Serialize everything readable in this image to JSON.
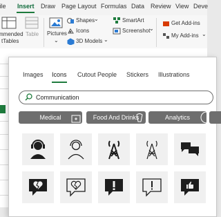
{
  "menubar": {
    "items": [
      "File",
      "Insert",
      "Draw",
      "Page Layout",
      "Formulas",
      "Data",
      "Review",
      "View",
      "Deve"
    ],
    "active": "Insert"
  },
  "ribbon": {
    "recommended": "mmended",
    "pivot": "tTables",
    "table": "Table",
    "pictures": "Pictures",
    "shapes": "Shapes",
    "icons": "Icons",
    "models": "3D Models",
    "smartart": "SmartArt",
    "screenshot": "Screenshot",
    "get_addins": "Get Add-ins",
    "my_addins": "My Add-ins"
  },
  "dialog": {
    "tabs": [
      "Images",
      "Icons",
      "Cutout People",
      "Stickers",
      "Illustrations"
    ],
    "active_tab": "Icons",
    "search_value": "Communication",
    "categories": [
      "Medical",
      "Food And Drinks",
      "Analytics"
    ],
    "icons": [
      "headset-person-dark-icon",
      "headset-person-outline-icon",
      "radio-tower-dark-icon",
      "radio-tower-outline-icon",
      "speech-bubbles-icon",
      "broken-heart-bubble-icon",
      "broken-heart-outline-bubble-icon",
      "exclamation-bubble-icon",
      "exclamation-outline-bubble-icon",
      "thumbs-up-bubble-icon"
    ]
  },
  "colors": {
    "accent": "#1e7b3d",
    "chip": "#6e6e6e",
    "tile": "#f0f0f0"
  }
}
